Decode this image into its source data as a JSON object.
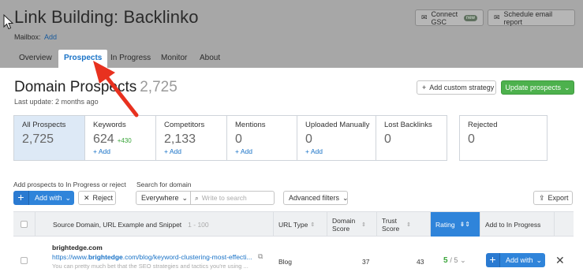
{
  "header": {
    "title": "Link Building: Backlinko",
    "mailbox_label": "Mailbox:",
    "mailbox_add": "Add",
    "connect_gsc": "Connect GSC",
    "new_badge": "new",
    "schedule_email": "Schedule email report"
  },
  "tabs": [
    {
      "label": "Overview"
    },
    {
      "label": "Prospects",
      "active": true
    },
    {
      "label": "In Progress"
    },
    {
      "label": "Monitor"
    },
    {
      "label": "About"
    }
  ],
  "main": {
    "title": "Domain Prospects",
    "count": "2,725",
    "last_update": "Last update: 2 months ago",
    "add_custom": "Add custom strategy",
    "update_prospects": "Update prospects"
  },
  "cards": [
    {
      "label": "All Prospects",
      "value": "2,725",
      "delta": "",
      "add": ""
    },
    {
      "label": "Keywords",
      "value": "624",
      "delta": "+430",
      "add": "+ Add"
    },
    {
      "label": "Competitors",
      "value": "2,133",
      "delta": "",
      "add": "+ Add"
    },
    {
      "label": "Mentions",
      "value": "0",
      "delta": "",
      "add": "+ Add"
    },
    {
      "label": "Uploaded Manually",
      "value": "0",
      "delta": "",
      "add": "+ Add"
    },
    {
      "label": "Lost Backlinks",
      "value": "0",
      "delta": "",
      "add": ""
    }
  ],
  "rejected": {
    "label": "Rejected",
    "value": "0"
  },
  "filters": {
    "add_prospects_label": "Add prospects to In Progress or reject",
    "search_domain_label": "Search for domain",
    "add_with": "Add with",
    "reject": "Reject",
    "scope": "Everywhere",
    "search_placeholder": "Write to search",
    "advanced": "Advanced filters",
    "export": "Export"
  },
  "table": {
    "col_source": "Source Domain, URL Example and Snippet",
    "col_source_range": "1 - 100",
    "col_url_type": "URL Type",
    "col_domain_score": "Domain Score",
    "col_trust_score": "Trust Score",
    "col_rating": "Rating",
    "col_add": "Add to In Progress",
    "rows": [
      {
        "domain": "brightedge.com",
        "url_prefix": "https://www.",
        "url_domain": "brightedge",
        "url_rest": ".com/blog/keyword-clustering-most-effecti...",
        "snippet": "You can pretty much bet that the SEO strategies and tactics you're using ...",
        "url_type": "Blog",
        "domain_score": "37",
        "trust_score": "43",
        "rating": "5",
        "rating_of": "/ 5",
        "add_with": "Add with"
      }
    ]
  },
  "colors": {
    "accent": "#2f84da",
    "green": "#4db14d",
    "arrow": "#e8311f"
  }
}
